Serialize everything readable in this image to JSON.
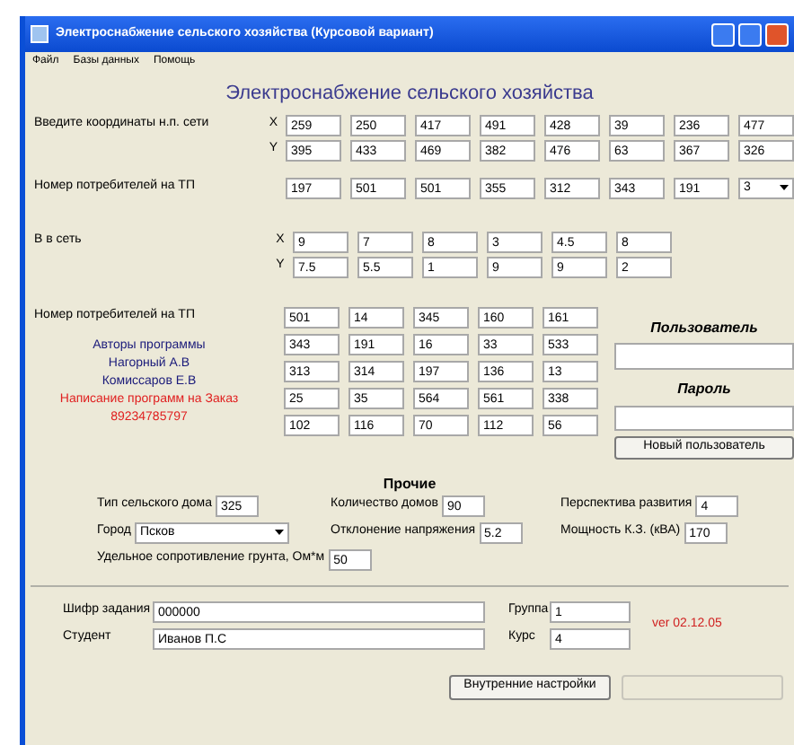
{
  "window": {
    "title": "Электроснабжение сельского хозяйства (Курсовой вариант)"
  },
  "menu": [
    "Файл",
    "Базы данных",
    "Помощь"
  ],
  "heading": "Электроснабжение сельского хозяйства",
  "coordinates": {
    "label": "Введите координаты н.п. сети",
    "rows": [
      {
        "axis": "X",
        "values": [
          "259",
          "250",
          "417",
          "491",
          "428",
          "39",
          "236",
          "477"
        ]
      },
      {
        "axis": "Y",
        "values": [
          "395",
          "433",
          "469",
          "382",
          "476",
          "63",
          "367",
          "326"
        ]
      }
    ]
  },
  "consumers": {
    "label": "Номер потребителей на ТП",
    "values": [
      "197",
      "501",
      "501",
      "355",
      "312",
      "343",
      "191"
    ],
    "select": "3"
  },
  "network": {
    "label": "В в сеть",
    "rows": [
      {
        "axis": "X",
        "values": [
          "9",
          "7",
          "8",
          "3",
          "4.5",
          "8"
        ]
      },
      {
        "axis": "Y",
        "values": [
          "7.5",
          "5.5",
          "1",
          "9",
          "9",
          "2"
        ]
      }
    ]
  },
  "grid": {
    "label": "Номер потребителей на ТП",
    "rows": [
      [
        "501",
        "14",
        "345",
        "160",
        "161"
      ],
      [
        "343",
        "191",
        "16",
        "33",
        "533"
      ],
      [
        "313",
        "314",
        "197",
        "136",
        "13"
      ],
      [
        "25",
        "35",
        "564",
        "561",
        "338"
      ],
      [
        "102",
        "116",
        "70",
        "112",
        "56"
      ]
    ]
  },
  "authors": [
    {
      "kind": "title",
      "text": "Авторы программы"
    },
    {
      "kind": "name",
      "text": "Нагорный А.В"
    },
    {
      "kind": "name",
      "text": "Комиссаров Е.В"
    },
    {
      "kind": "promo",
      "text": "Написание программ на Заказ"
    },
    {
      "kind": "promo",
      "text": "89234785797"
    }
  ],
  "login": {
    "user_label": "Пользователь",
    "password_label": "Пароль",
    "button": "Новый пользователь"
  },
  "other": {
    "title": "Прочие",
    "rows": [
      [
        {
          "label": "Тип сельского дома",
          "value": "325",
          "kind": "input"
        },
        {
          "label": "Количество домов",
          "value": "90",
          "kind": "input"
        },
        {
          "label": "Перспектива развития",
          "value": "4",
          "kind": "input"
        }
      ],
      [
        {
          "label": "Город",
          "value": "Псков",
          "kind": "select"
        },
        {
          "label": "Отклонение напряжения",
          "value": "5.2",
          "kind": "input"
        },
        {
          "label": "Мощность К.З. (кВА)",
          "value": "170",
          "kind": "input"
        }
      ],
      [
        {
          "label": "Удельное сопротивление грунта, Ом*м",
          "value": "50",
          "kind": "input"
        }
      ]
    ]
  },
  "student": {
    "fields": [
      {
        "label": "Шифр задания",
        "value": "000000"
      },
      {
        "label": "Студент",
        "value": "Иванов П.С"
      }
    ],
    "side_fields": [
      {
        "label": "Группа",
        "value": "1"
      },
      {
        "label": "Курс",
        "value": "4"
      }
    ],
    "version": "ver 02.12.05"
  },
  "buttons": [
    {
      "label": "Внутренние настройки",
      "disabled": false
    },
    {
      "disabled": true
    }
  ]
}
